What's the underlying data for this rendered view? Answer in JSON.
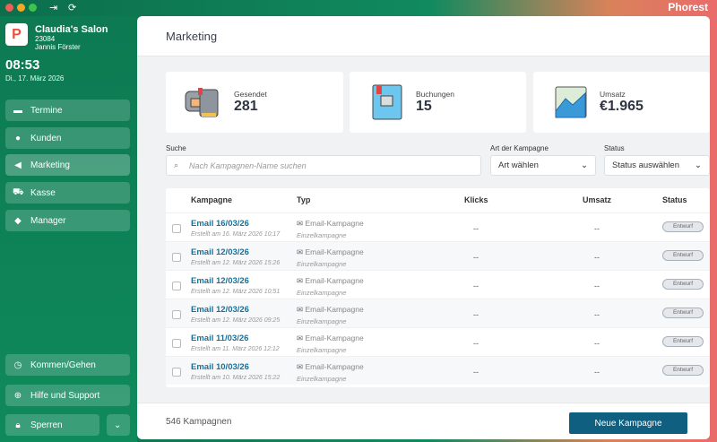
{
  "app": {
    "brand": "Phorest"
  },
  "sidebar": {
    "salon_name": "Claudia's Salon",
    "salon_id": "23084",
    "user": "Jannis Förster",
    "time": "08:53",
    "date": "Di., 17. März 2026",
    "items": [
      {
        "label": "Termine",
        "icon": "calendar-icon"
      },
      {
        "label": "Kunden",
        "icon": "user-icon"
      },
      {
        "label": "Marketing",
        "icon": "megaphone-icon"
      },
      {
        "label": "Kasse",
        "icon": "cart-icon"
      },
      {
        "label": "Manager",
        "icon": "layers-icon"
      }
    ],
    "bottom": {
      "clock": "Kommen/Gehen",
      "help": "Hilfe und Support",
      "lock": "Sperren"
    }
  },
  "header": {
    "title": "Marketing"
  },
  "stats": [
    {
      "label": "Gesendet",
      "value": "281"
    },
    {
      "label": "Buchungen",
      "value": "15"
    },
    {
      "label": "Umsatz",
      "value": "€1.965"
    }
  ],
  "filters": {
    "search_label": "Suche",
    "search_placeholder": "Nach Kampagnen-Name suchen",
    "type_label": "Art der Kampagne",
    "type_value": "Art wählen",
    "status_label": "Status",
    "status_value": "Status auswählen"
  },
  "table": {
    "columns": [
      "Kampagne",
      "Typ",
      "Klicks",
      "Umsatz",
      "Status"
    ],
    "rows": [
      {
        "name": "Email 16/03/26",
        "created": "Erstellt am 16. März 2026 10:17",
        "type": "Email-Kampagne",
        "subtype": "Einzelkampagne",
        "clicks": "--",
        "revenue": "--",
        "status": "Entwurf"
      },
      {
        "name": "Email 12/03/26",
        "created": "Erstellt am 12. März 2026 15:26",
        "type": "Email-Kampagne",
        "subtype": "Einzelkampagne",
        "clicks": "--",
        "revenue": "--",
        "status": "Entwurf"
      },
      {
        "name": "Email 12/03/26",
        "created": "Erstellt am 12. März 2026 10:51",
        "type": "Email-Kampagne",
        "subtype": "Einzelkampagne",
        "clicks": "--",
        "revenue": "--",
        "status": "Entwurf"
      },
      {
        "name": "Email 12/03/26",
        "created": "Erstellt am 12. März 2026 09:25",
        "type": "Email-Kampagne",
        "subtype": "Einzelkampagne",
        "clicks": "--",
        "revenue": "--",
        "status": "Entwurf"
      },
      {
        "name": "Email 11/03/26",
        "created": "Erstellt am 11. März 2026 12:12",
        "type": "Email-Kampagne",
        "subtype": "Einzelkampagne",
        "clicks": "--",
        "revenue": "--",
        "status": "Entwurf"
      },
      {
        "name": "Email 10/03/26",
        "created": "Erstellt am 10. März 2026 15:22",
        "type": "Email-Kampagne",
        "subtype": "Einzelkampagne",
        "clicks": "--",
        "revenue": "--",
        "status": "Entwurf"
      }
    ]
  },
  "footer": {
    "count": "546 Kampagnen",
    "new_button": "Neue Kampagne"
  },
  "colors": {
    "sidebar": "#0d7a52",
    "primary": "#0e5f80",
    "link": "#1c6f96"
  }
}
